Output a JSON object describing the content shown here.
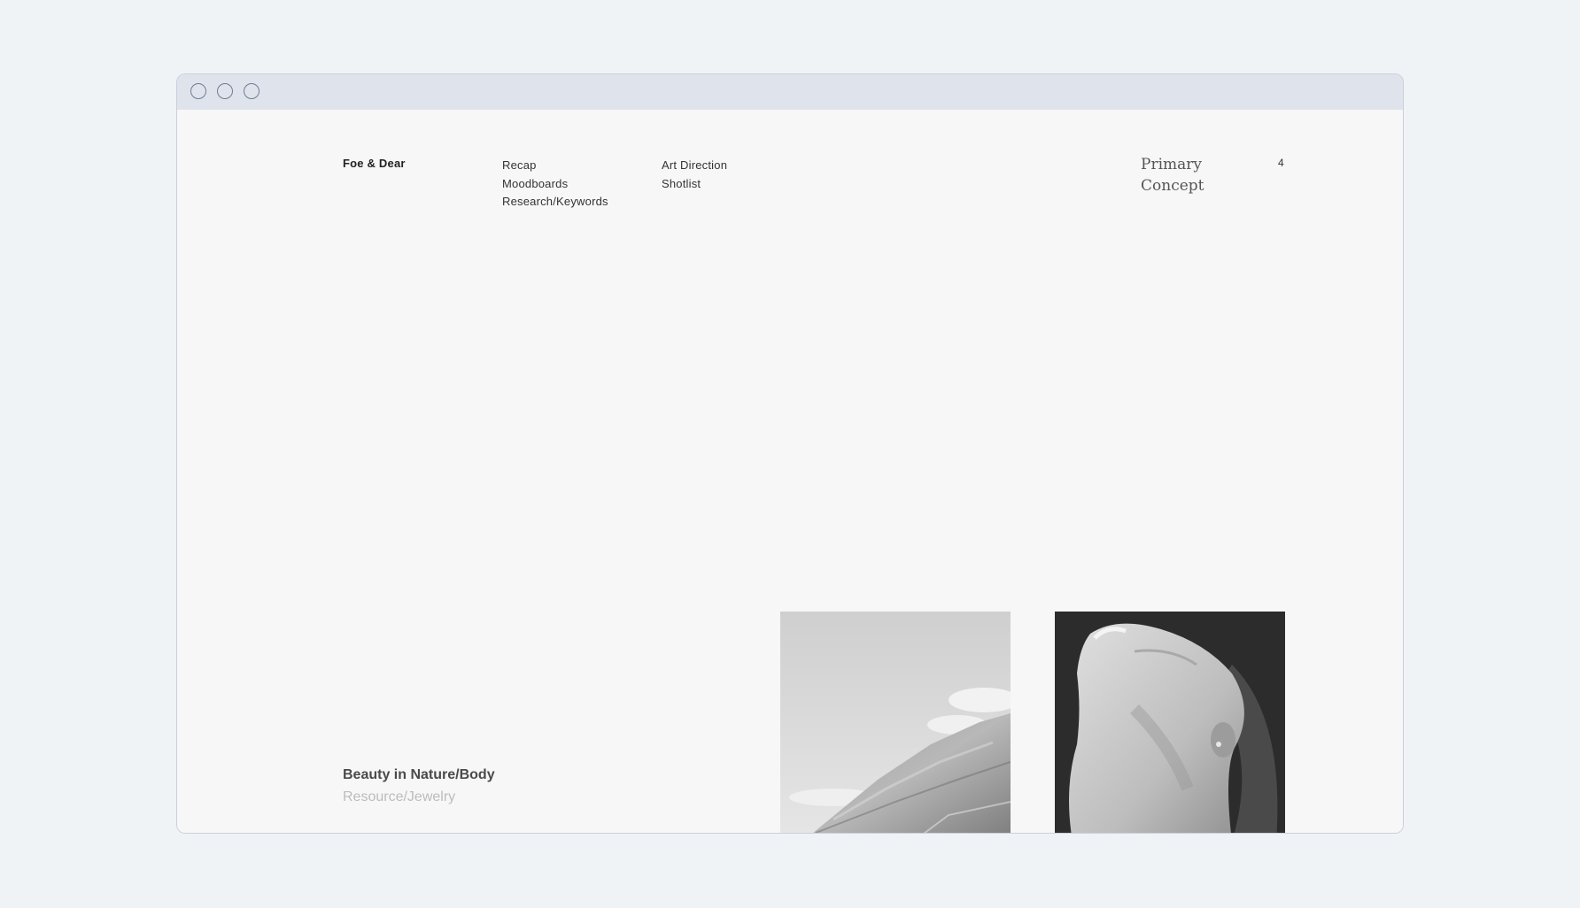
{
  "page": {
    "brand": "Foe & Dear",
    "nav": {
      "col1": [
        "Recap",
        "Moodboards",
        "Research/Keywords"
      ],
      "col2": [
        "Art Direction",
        "Shotlist"
      ]
    },
    "section_title": [
      "Primary",
      "Concept"
    ],
    "page_number": "4",
    "caption": {
      "title": "Beauty in Nature/Body",
      "subtitle": "Resource/Jewelry"
    },
    "images": [
      {
        "name": "mountain-photo"
      },
      {
        "name": "portrait-photo"
      }
    ]
  },
  "colors": {
    "page_bg": "#eff3f6",
    "window_bg": "#f7f7f7",
    "titlebar": "#dfe4ec",
    "window_border": "#c9d0dc",
    "traffic_stroke": "#707a92"
  }
}
